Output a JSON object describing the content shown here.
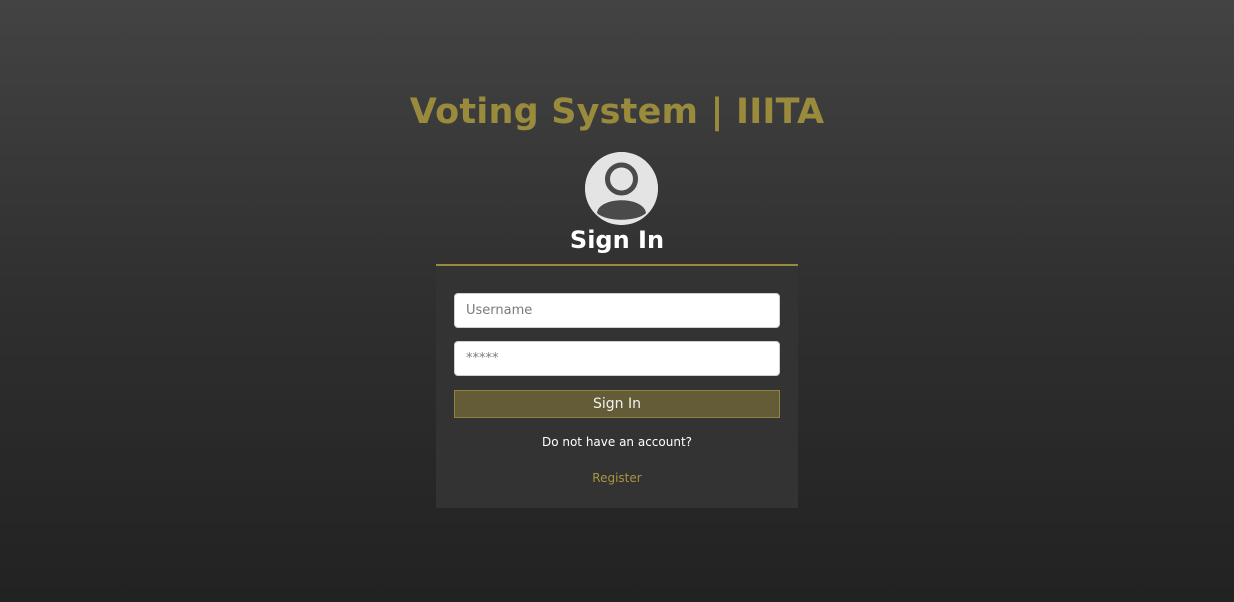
{
  "header": {
    "title": "Voting System | IIITA"
  },
  "login": {
    "heading": "Sign In",
    "avatar_icon": "user-avatar-icon",
    "username_placeholder": "Username",
    "password_placeholder": "*****",
    "submit_label": "Sign In",
    "no_account_text": "Do not have an account?",
    "register_label": "Register"
  },
  "colors": {
    "accent": "#9a8b3c",
    "button_bg": "#645c36",
    "card_bg": "#333333"
  }
}
